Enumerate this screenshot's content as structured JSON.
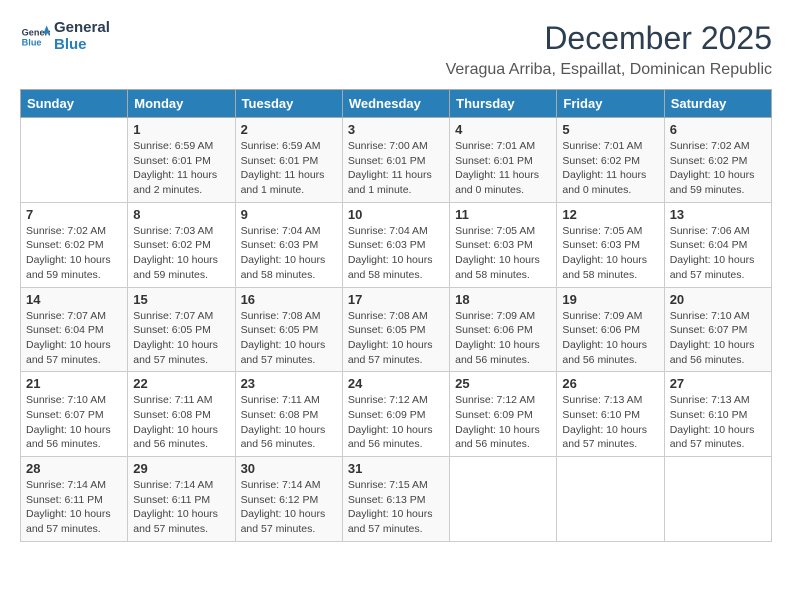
{
  "logo": {
    "general": "General",
    "blue": "Blue"
  },
  "month": "December 2025",
  "location": "Veragua Arriba, Espaillat, Dominican Republic",
  "days_header": [
    "Sunday",
    "Monday",
    "Tuesday",
    "Wednesday",
    "Thursday",
    "Friday",
    "Saturday"
  ],
  "weeks": [
    [
      {
        "day": "",
        "detail": ""
      },
      {
        "day": "1",
        "detail": "Sunrise: 6:59 AM\nSunset: 6:01 PM\nDaylight: 11 hours\nand 2 minutes."
      },
      {
        "day": "2",
        "detail": "Sunrise: 6:59 AM\nSunset: 6:01 PM\nDaylight: 11 hours\nand 1 minute."
      },
      {
        "day": "3",
        "detail": "Sunrise: 7:00 AM\nSunset: 6:01 PM\nDaylight: 11 hours\nand 1 minute."
      },
      {
        "day": "4",
        "detail": "Sunrise: 7:01 AM\nSunset: 6:01 PM\nDaylight: 11 hours\nand 0 minutes."
      },
      {
        "day": "5",
        "detail": "Sunrise: 7:01 AM\nSunset: 6:02 PM\nDaylight: 11 hours\nand 0 minutes."
      },
      {
        "day": "6",
        "detail": "Sunrise: 7:02 AM\nSunset: 6:02 PM\nDaylight: 10 hours\nand 59 minutes."
      }
    ],
    [
      {
        "day": "7",
        "detail": "Sunrise: 7:02 AM\nSunset: 6:02 PM\nDaylight: 10 hours\nand 59 minutes."
      },
      {
        "day": "8",
        "detail": "Sunrise: 7:03 AM\nSunset: 6:02 PM\nDaylight: 10 hours\nand 59 minutes."
      },
      {
        "day": "9",
        "detail": "Sunrise: 7:04 AM\nSunset: 6:03 PM\nDaylight: 10 hours\nand 58 minutes."
      },
      {
        "day": "10",
        "detail": "Sunrise: 7:04 AM\nSunset: 6:03 PM\nDaylight: 10 hours\nand 58 minutes."
      },
      {
        "day": "11",
        "detail": "Sunrise: 7:05 AM\nSunset: 6:03 PM\nDaylight: 10 hours\nand 58 minutes."
      },
      {
        "day": "12",
        "detail": "Sunrise: 7:05 AM\nSunset: 6:03 PM\nDaylight: 10 hours\nand 58 minutes."
      },
      {
        "day": "13",
        "detail": "Sunrise: 7:06 AM\nSunset: 6:04 PM\nDaylight: 10 hours\nand 57 minutes."
      }
    ],
    [
      {
        "day": "14",
        "detail": "Sunrise: 7:07 AM\nSunset: 6:04 PM\nDaylight: 10 hours\nand 57 minutes."
      },
      {
        "day": "15",
        "detail": "Sunrise: 7:07 AM\nSunset: 6:05 PM\nDaylight: 10 hours\nand 57 minutes."
      },
      {
        "day": "16",
        "detail": "Sunrise: 7:08 AM\nSunset: 6:05 PM\nDaylight: 10 hours\nand 57 minutes."
      },
      {
        "day": "17",
        "detail": "Sunrise: 7:08 AM\nSunset: 6:05 PM\nDaylight: 10 hours\nand 57 minutes."
      },
      {
        "day": "18",
        "detail": "Sunrise: 7:09 AM\nSunset: 6:06 PM\nDaylight: 10 hours\nand 56 minutes."
      },
      {
        "day": "19",
        "detail": "Sunrise: 7:09 AM\nSunset: 6:06 PM\nDaylight: 10 hours\nand 56 minutes."
      },
      {
        "day": "20",
        "detail": "Sunrise: 7:10 AM\nSunset: 6:07 PM\nDaylight: 10 hours\nand 56 minutes."
      }
    ],
    [
      {
        "day": "21",
        "detail": "Sunrise: 7:10 AM\nSunset: 6:07 PM\nDaylight: 10 hours\nand 56 minutes."
      },
      {
        "day": "22",
        "detail": "Sunrise: 7:11 AM\nSunset: 6:08 PM\nDaylight: 10 hours\nand 56 minutes."
      },
      {
        "day": "23",
        "detail": "Sunrise: 7:11 AM\nSunset: 6:08 PM\nDaylight: 10 hours\nand 56 minutes."
      },
      {
        "day": "24",
        "detail": "Sunrise: 7:12 AM\nSunset: 6:09 PM\nDaylight: 10 hours\nand 56 minutes."
      },
      {
        "day": "25",
        "detail": "Sunrise: 7:12 AM\nSunset: 6:09 PM\nDaylight: 10 hours\nand 56 minutes."
      },
      {
        "day": "26",
        "detail": "Sunrise: 7:13 AM\nSunset: 6:10 PM\nDaylight: 10 hours\nand 57 minutes."
      },
      {
        "day": "27",
        "detail": "Sunrise: 7:13 AM\nSunset: 6:10 PM\nDaylight: 10 hours\nand 57 minutes."
      }
    ],
    [
      {
        "day": "28",
        "detail": "Sunrise: 7:14 AM\nSunset: 6:11 PM\nDaylight: 10 hours\nand 57 minutes."
      },
      {
        "day": "29",
        "detail": "Sunrise: 7:14 AM\nSunset: 6:11 PM\nDaylight: 10 hours\nand 57 minutes."
      },
      {
        "day": "30",
        "detail": "Sunrise: 7:14 AM\nSunset: 6:12 PM\nDaylight: 10 hours\nand 57 minutes."
      },
      {
        "day": "31",
        "detail": "Sunrise: 7:15 AM\nSunset: 6:13 PM\nDaylight: 10 hours\nand 57 minutes."
      },
      {
        "day": "",
        "detail": ""
      },
      {
        "day": "",
        "detail": ""
      },
      {
        "day": "",
        "detail": ""
      }
    ]
  ]
}
